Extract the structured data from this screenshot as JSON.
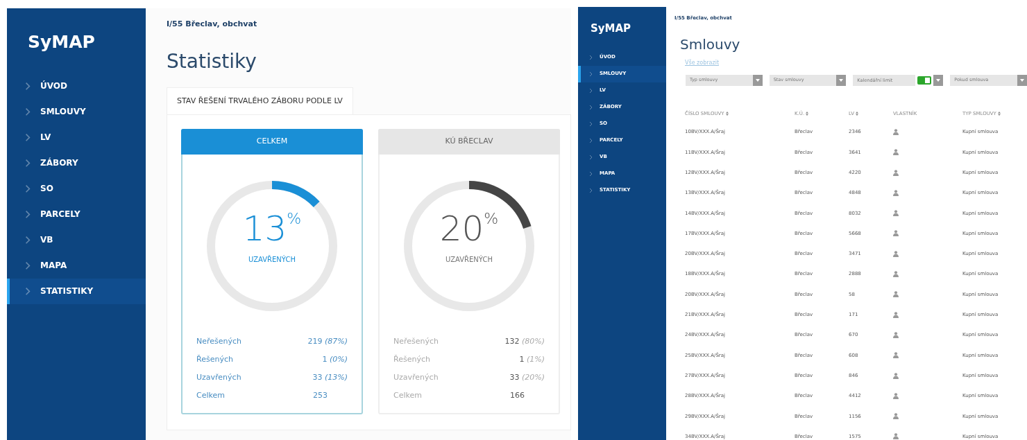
{
  "left_screen": {
    "sidebar": {
      "logo": "SyMAP",
      "items": [
        {
          "label": "ÚVOD",
          "selected": false
        },
        {
          "label": "SMLOUVY",
          "selected": false
        },
        {
          "label": "LV",
          "selected": false
        },
        {
          "label": "ZÁBORY",
          "selected": false
        },
        {
          "label": "SO",
          "selected": false
        },
        {
          "label": "PARCELY",
          "selected": false
        },
        {
          "label": "VB",
          "selected": false
        },
        {
          "label": "MAPA",
          "selected": false
        },
        {
          "label": "STATISTIKY",
          "selected": true
        }
      ]
    },
    "breadcrumb": "I/55 Břeclav, obchvat",
    "title": "Statistiky",
    "panel_tab": "STAV ŘEŠENÍ TRVALÉHO ZÁBORU PODLE LV",
    "cards": [
      {
        "title": "CELKEM",
        "selected": true,
        "level": 0.13,
        "percent": "13",
        "percent_sign": "%",
        "caption": "UZAVŘENÝCH",
        "stats": [
          {
            "label": "Neřešených",
            "value": "219",
            "share": "(87%)"
          },
          {
            "label": "Řešených",
            "value": "1",
            "share": "(0%)"
          },
          {
            "label": "Uzavřených",
            "value": "33",
            "share": "(13%)"
          },
          {
            "label": "Celkem",
            "value": "253"
          }
        ]
      },
      {
        "title": "KÚ BŘECLAV",
        "selected": false,
        "level": 0.2,
        "percent": "20",
        "percent_sign": "%",
        "caption": "UZAVŘENÝCH",
        "stats": [
          {
            "label": "Neřešených",
            "value": "132",
            "share": "(80%)"
          },
          {
            "label": "Řešených",
            "value": "1",
            "share": "(1%)"
          },
          {
            "label": "Uzavřených",
            "value": "33",
            "share": "(20%)"
          },
          {
            "label": "Celkem",
            "value": "166"
          }
        ]
      }
    ]
  },
  "right_screen": {
    "sidebar": {
      "logo": "SyMAP",
      "items": [
        {
          "label": "ÚVOD",
          "selected": false
        },
        {
          "label": "SMLOUVY",
          "selected": true
        },
        {
          "label": "LV",
          "selected": false
        },
        {
          "label": "ZÁBORY",
          "selected": false
        },
        {
          "label": "SO",
          "selected": false
        },
        {
          "label": "PARCELY",
          "selected": false
        },
        {
          "label": "VB",
          "selected": false
        },
        {
          "label": "MAPA",
          "selected": false
        },
        {
          "label": "STATISTIKY",
          "selected": false
        }
      ]
    },
    "breadcrumb": "I/55 Břeclav, obchvat",
    "title": "Smlouvy",
    "filter_link": "Vše zobrazit",
    "filters": [
      {
        "kind": "select",
        "placeholder": "Typ smlouvy"
      },
      {
        "kind": "select",
        "placeholder": "Stav smlouvy"
      },
      {
        "kind": "toggle",
        "label": "Kalendářní limit",
        "on": true
      },
      {
        "kind": "select",
        "placeholder": "Pokud smlouva"
      }
    ],
    "table": {
      "columns": [
        {
          "label": "ČÍSLO SMLOUVY",
          "sortable": true
        },
        {
          "label": "K.Ú.",
          "sortable": true
        },
        {
          "label": "LV",
          "sortable": true
        },
        {
          "label": "VLASTNÍK",
          "sortable": false
        },
        {
          "label": "TYP SMLOUVY",
          "sortable": true
        }
      ],
      "rows": [
        {
          "number": "10BV/XXX.A/Šraj",
          "ku": "Břeclav",
          "lv": "2346",
          "type": "Kupní smlouva"
        },
        {
          "number": "11BV/XXX.A/Šraj",
          "ku": "Břeclav",
          "lv": "3641",
          "type": "Kupní smlouva"
        },
        {
          "number": "12BV/XXX.A/Šraj",
          "ku": "Břeclav",
          "lv": "4220",
          "type": "Kupní smlouva"
        },
        {
          "number": "13BV/XXX.A/Šraj",
          "ku": "Břeclav",
          "lv": "4848",
          "type": "Kupní smlouva"
        },
        {
          "number": "14BV/XXX.A/Šraj",
          "ku": "Břeclav",
          "lv": "8032",
          "type": "Kupní smlouva"
        },
        {
          "number": "17BV/XXX.A/Šraj",
          "ku": "Břeclav",
          "lv": "5668",
          "type": "Kupní smlouva"
        },
        {
          "number": "20BV/XXX.A/Šraj",
          "ku": "Břeclav",
          "lv": "3471",
          "type": "Kupní smlouva"
        },
        {
          "number": "18BV/XXX.A/Šraj",
          "ku": "Břeclav",
          "lv": "2888",
          "type": "Kupní smlouva"
        },
        {
          "number": "20BV/XXX.A/Šraj",
          "ku": "Břeclav",
          "lv": "58",
          "type": "Kupní smlouva"
        },
        {
          "number": "21BV/XXX.A/Šraj",
          "ku": "Břeclav",
          "lv": "171",
          "type": "Kupní smlouva"
        },
        {
          "number": "24BV/XXX.A/Šraj",
          "ku": "Břeclav",
          "lv": "670",
          "type": "Kupní smlouva"
        },
        {
          "number": "25BV/XXX.A/Šraj",
          "ku": "Břeclav",
          "lv": "608",
          "type": "Kupní smlouva"
        },
        {
          "number": "27BV/XXX.A/Šraj",
          "ku": "Břeclav",
          "lv": "846",
          "type": "Kupní smlouva"
        },
        {
          "number": "28BV/XXX.A/Šraj",
          "ku": "Břeclav",
          "lv": "4412",
          "type": "Kupní smlouva"
        },
        {
          "number": "29BV/XXX.A/Šraj",
          "ku": "Břeclav",
          "lv": "1156",
          "type": "Kupní smlouva"
        },
        {
          "number": "34BV/XXX.A/Šraj",
          "ku": "Břeclav",
          "lv": "1575",
          "type": "Kupní smlouva"
        }
      ]
    }
  }
}
